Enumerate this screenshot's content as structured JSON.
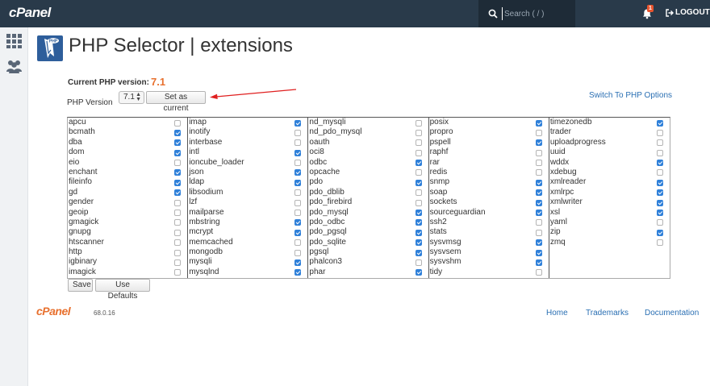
{
  "header": {
    "logo": "cPanel",
    "search_placeholder": "Search ( / )",
    "notification_count": "1",
    "logout_label": "LOGOUT"
  },
  "page": {
    "title": "PHP Selector | extensions",
    "current_version_label": "Current PHP version:",
    "current_version_value": "7.1",
    "php_version_label": "PHP Version",
    "selected_version": "7.1",
    "set_current_label": "Set as current",
    "switch_link": "Switch To PHP Options",
    "save_label": "Save",
    "defaults_label": "Use Defaults"
  },
  "extensions": [
    [
      {
        "name": "apcu",
        "checked": false
      },
      {
        "name": "bcmath",
        "checked": true
      },
      {
        "name": "dba",
        "checked": true
      },
      {
        "name": "dom",
        "checked": true
      },
      {
        "name": "eio",
        "checked": false
      },
      {
        "name": "enchant",
        "checked": true
      },
      {
        "name": "fileinfo",
        "checked": true
      },
      {
        "name": "gd",
        "checked": true
      },
      {
        "name": "gender",
        "checked": false
      },
      {
        "name": "geoip",
        "checked": false
      },
      {
        "name": "gmagick",
        "checked": false
      },
      {
        "name": "gnupg",
        "checked": false
      },
      {
        "name": "htscanner",
        "checked": false
      },
      {
        "name": "http",
        "checked": false
      },
      {
        "name": "igbinary",
        "checked": false
      },
      {
        "name": "imagick",
        "checked": false
      }
    ],
    [
      {
        "name": "imap",
        "checked": true
      },
      {
        "name": "inotify",
        "checked": false
      },
      {
        "name": "interbase",
        "checked": false
      },
      {
        "name": "intl",
        "checked": true
      },
      {
        "name": "ioncube_loader",
        "checked": false
      },
      {
        "name": "json",
        "checked": true
      },
      {
        "name": "ldap",
        "checked": true
      },
      {
        "name": "libsodium",
        "checked": false
      },
      {
        "name": "lzf",
        "checked": false
      },
      {
        "name": "mailparse",
        "checked": false
      },
      {
        "name": "mbstring",
        "checked": true
      },
      {
        "name": "mcrypt",
        "checked": true
      },
      {
        "name": "memcached",
        "checked": false
      },
      {
        "name": "mongodb",
        "checked": false
      },
      {
        "name": "mysqli",
        "checked": true
      },
      {
        "name": "mysqlnd",
        "checked": true
      }
    ],
    [
      {
        "name": "nd_mysqli",
        "checked": false
      },
      {
        "name": "nd_pdo_mysql",
        "checked": false
      },
      {
        "name": "oauth",
        "checked": false
      },
      {
        "name": "oci8",
        "checked": false
      },
      {
        "name": "odbc",
        "checked": true
      },
      {
        "name": "opcache",
        "checked": false
      },
      {
        "name": "pdo",
        "checked": true
      },
      {
        "name": "pdo_dblib",
        "checked": false
      },
      {
        "name": "pdo_firebird",
        "checked": false
      },
      {
        "name": "pdo_mysql",
        "checked": true
      },
      {
        "name": "pdo_odbc",
        "checked": true
      },
      {
        "name": "pdo_pgsql",
        "checked": true
      },
      {
        "name": "pdo_sqlite",
        "checked": true
      },
      {
        "name": "pgsql",
        "checked": true
      },
      {
        "name": "phalcon3",
        "checked": false
      },
      {
        "name": "phar",
        "checked": true
      }
    ],
    [
      {
        "name": "posix",
        "checked": true
      },
      {
        "name": "propro",
        "checked": false
      },
      {
        "name": "pspell",
        "checked": true
      },
      {
        "name": "raphf",
        "checked": false
      },
      {
        "name": "rar",
        "checked": false
      },
      {
        "name": "redis",
        "checked": false
      },
      {
        "name": "snmp",
        "checked": true
      },
      {
        "name": "soap",
        "checked": true
      },
      {
        "name": "sockets",
        "checked": true
      },
      {
        "name": "sourceguardian",
        "checked": true
      },
      {
        "name": "ssh2",
        "checked": false
      },
      {
        "name": "stats",
        "checked": false
      },
      {
        "name": "sysvmsg",
        "checked": true
      },
      {
        "name": "sysvsem",
        "checked": true
      },
      {
        "name": "sysvshm",
        "checked": true
      },
      {
        "name": "tidy",
        "checked": false
      }
    ],
    [
      {
        "name": "timezonedb",
        "checked": true
      },
      {
        "name": "trader",
        "checked": false
      },
      {
        "name": "uploadprogress",
        "checked": false
      },
      {
        "name": "uuid",
        "checked": false
      },
      {
        "name": "wddx",
        "checked": true
      },
      {
        "name": "xdebug",
        "checked": false
      },
      {
        "name": "xmlreader",
        "checked": true
      },
      {
        "name": "xmlrpc",
        "checked": true
      },
      {
        "name": "xmlwriter",
        "checked": true
      },
      {
        "name": "xsl",
        "checked": true
      },
      {
        "name": "yaml",
        "checked": false
      },
      {
        "name": "zip",
        "checked": true
      },
      {
        "name": "zmq",
        "checked": false
      }
    ]
  ],
  "footer": {
    "logo": "cPanel",
    "version": "68.0.16",
    "links": [
      "Home",
      "Trademarks",
      "Documentation"
    ]
  },
  "colors": {
    "topbar": "#293a4a",
    "accent": "#e8712f",
    "checkbox_on": "#2f80d9",
    "link": "#2a6fb3"
  },
  "icons": {
    "search": "search-icon",
    "bell": "bell-icon",
    "logout": "logout-icon",
    "grid": "grid-icon",
    "users": "users-icon",
    "php": "php-selector-icon"
  }
}
